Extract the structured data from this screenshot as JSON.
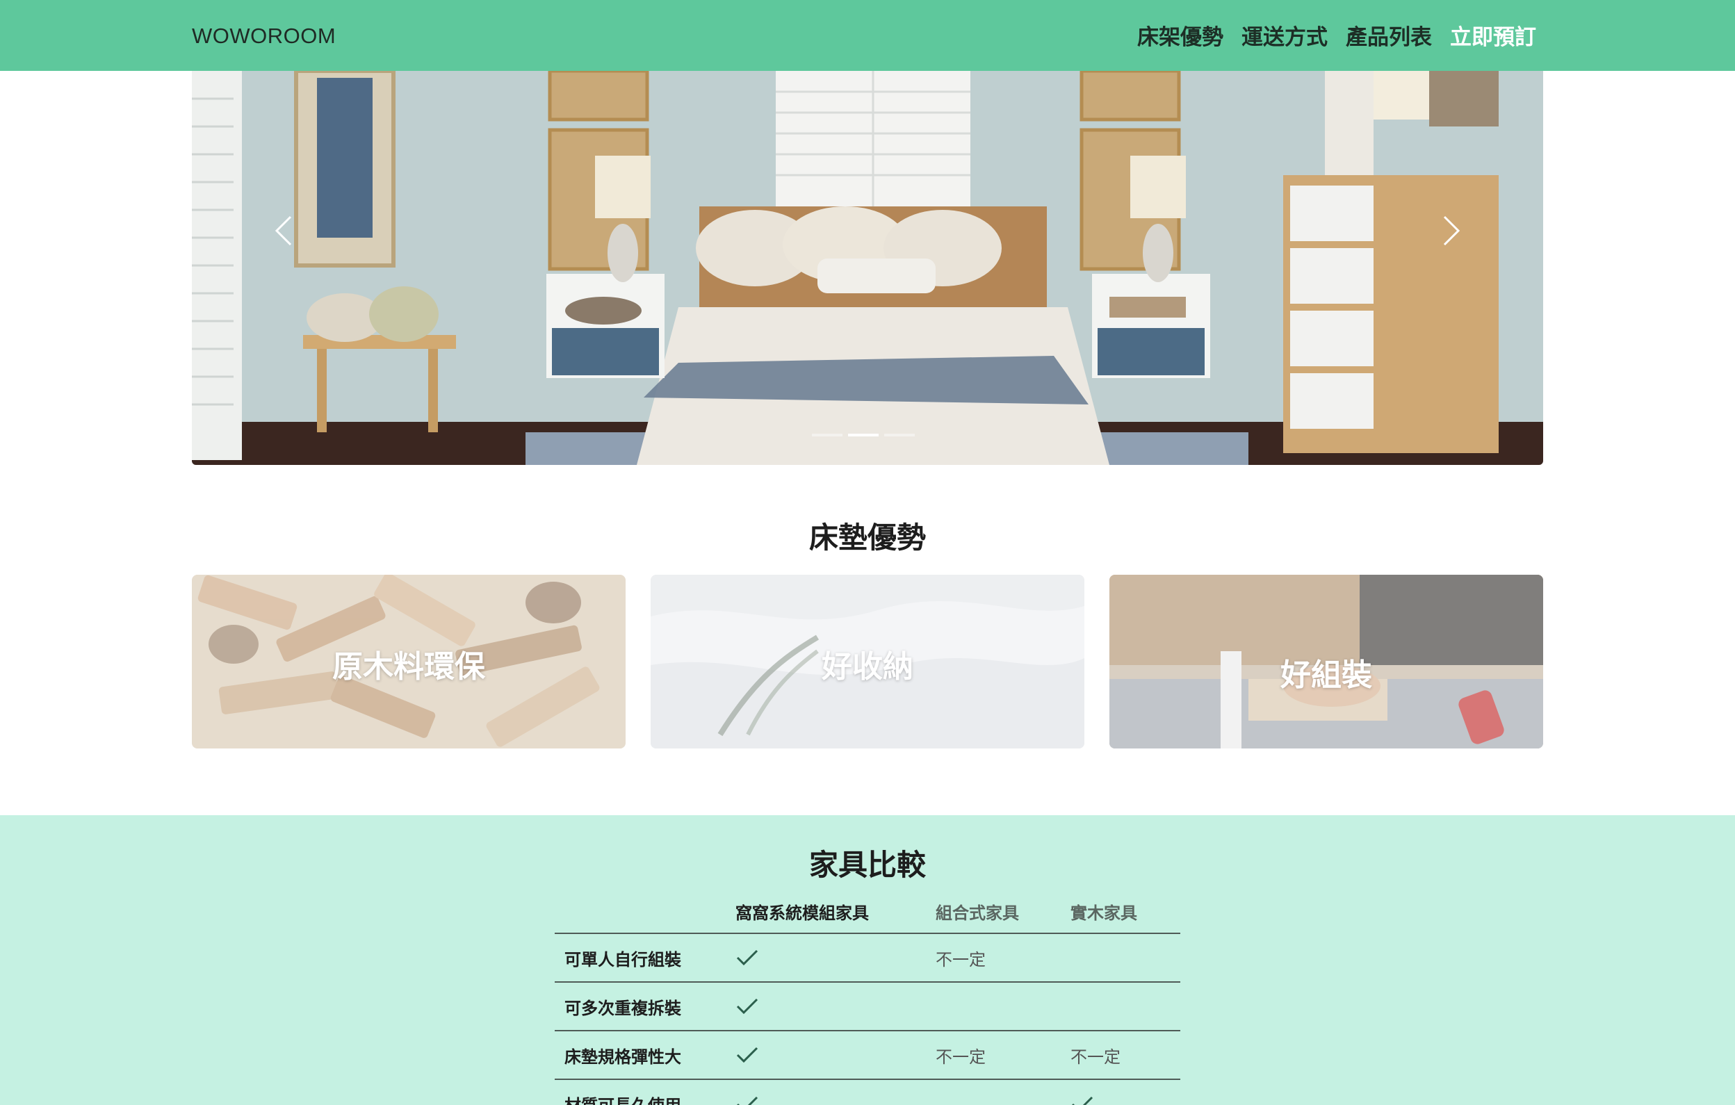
{
  "header": {
    "brand": "WOWOROOM",
    "nav": [
      {
        "label": "床架優勢"
      },
      {
        "label": "運送方式"
      },
      {
        "label": "產品列表"
      },
      {
        "label": "立即預訂"
      }
    ]
  },
  "carousel": {
    "slide_count": 3,
    "active_slide": 2
  },
  "advantages": {
    "title": "床墊優勢",
    "cards": [
      {
        "label": "原木料環保",
        "image": "wood-logs"
      },
      {
        "label": "好收納",
        "image": "bed-sheets"
      },
      {
        "label": "好組裝",
        "image": "woodworking"
      }
    ]
  },
  "comparison": {
    "title": "家具比較",
    "columns": [
      "",
      "窩窩系統模組家具",
      "組合式家具",
      "實木家具"
    ],
    "rows": [
      {
        "label": "可單人自行組裝",
        "values": [
          "check",
          "不一定",
          ""
        ]
      },
      {
        "label": "可多次重複拆裝",
        "values": [
          "check",
          "",
          ""
        ]
      },
      {
        "label": "床墊規格彈性大",
        "values": [
          "check",
          "不一定",
          "不一定"
        ]
      },
      {
        "label": "材質可長久使用",
        "values": [
          "check",
          "",
          "check"
        ]
      }
    ]
  },
  "colors": {
    "navbar": "#5ec89c",
    "compare_bg": "#c5f1e2",
    "nav_cta": "#ffffff"
  }
}
